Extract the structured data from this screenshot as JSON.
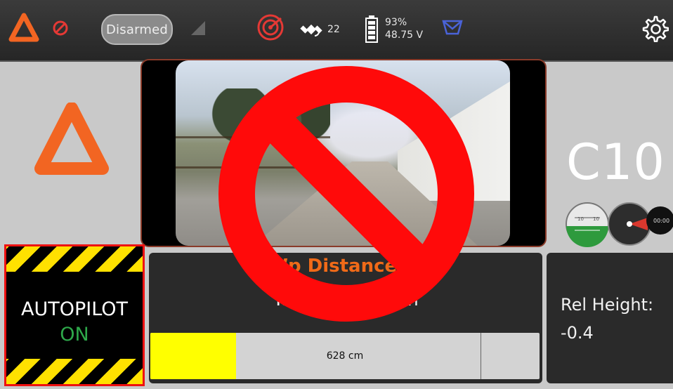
{
  "topbar": {
    "arm_status": "Disarmed",
    "gps_satellites": "22",
    "battery_percent": "93%",
    "battery_voltage": "48.75 V",
    "icons": [
      "logo-icon",
      "no-entry-icon",
      "signal-icon",
      "radar-icon",
      "gps-satellite-icon",
      "battery-icon",
      "envelope-icon",
      "gear-icon"
    ],
    "colors": {
      "logo": "#f26522",
      "alert": "#e53935",
      "envelope": "#4a63d8"
    }
  },
  "vehicle": {
    "name": "C10",
    "gauges": {
      "attitude_left": "10",
      "attitude_right": "10",
      "compass_readout": "00:00"
    }
  },
  "autopilot": {
    "label": "AUTOPILOT",
    "state": "ON"
  },
  "waypoint": {
    "warning": "Wp Distance: 7",
    "target": "Target Alt: 10 m",
    "progress_label": "628 cm",
    "progress_fraction": 0.22
  },
  "rel_height": {
    "label": "Rel Height:",
    "value": "-0.4"
  }
}
